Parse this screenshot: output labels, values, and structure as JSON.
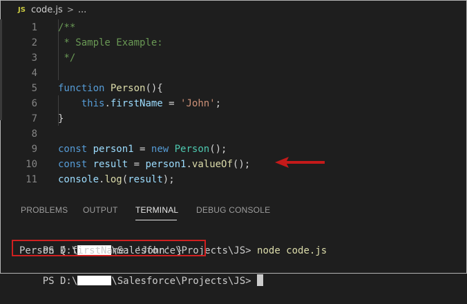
{
  "breadcrumb": {
    "badge": "JS",
    "file": "code.js",
    "separator": ">",
    "more": "..."
  },
  "editor": {
    "lines": [
      {
        "n": "1",
        "tokens": [
          [
            "cm",
            "/**"
          ]
        ]
      },
      {
        "n": "2",
        "tokens": [
          [
            "cm",
            " * Sample Example:"
          ]
        ]
      },
      {
        "n": "3",
        "tokens": [
          [
            "cm",
            " */"
          ]
        ]
      },
      {
        "n": "4",
        "tokens": []
      },
      {
        "n": "5",
        "tokens": [
          [
            "kw",
            "function "
          ],
          [
            "fn",
            "Person"
          ],
          [
            "plain",
            "(){"
          ]
        ]
      },
      {
        "n": "6",
        "tokens": [
          [
            "plain",
            "    "
          ],
          [
            "kw",
            "this"
          ],
          [
            "plain",
            "."
          ],
          [
            "var",
            "firstName"
          ],
          [
            "plain",
            " = "
          ],
          [
            "str",
            "'John'"
          ],
          [
            "plain",
            ";"
          ]
        ]
      },
      {
        "n": "7",
        "tokens": [
          [
            "plain",
            "}"
          ]
        ]
      },
      {
        "n": "8",
        "tokens": []
      },
      {
        "n": "9",
        "tokens": [
          [
            "kw",
            "const "
          ],
          [
            "var",
            "person1"
          ],
          [
            "plain",
            " = "
          ],
          [
            "kw",
            "new "
          ],
          [
            "cls",
            "Person"
          ],
          [
            "plain",
            "();"
          ]
        ]
      },
      {
        "n": "10",
        "tokens": [
          [
            "kw",
            "const "
          ],
          [
            "var",
            "result"
          ],
          [
            "plain",
            " = "
          ],
          [
            "var",
            "person1"
          ],
          [
            "plain",
            "."
          ],
          [
            "fn",
            "valueOf"
          ],
          [
            "plain",
            "();"
          ]
        ]
      },
      {
        "n": "11",
        "tokens": [
          [
            "var",
            "console"
          ],
          [
            "plain",
            "."
          ],
          [
            "fn",
            "log"
          ],
          [
            "plain",
            "("
          ],
          [
            "var",
            "result"
          ],
          [
            "plain",
            ");"
          ]
        ]
      }
    ]
  },
  "panel": {
    "tabs": [
      "PROBLEMS",
      "OUTPUT",
      "TERMINAL",
      "DEBUG CONSOLE"
    ],
    "active_tab": "TERMINAL"
  },
  "terminal": {
    "prompt_prefix": "PS D:\\",
    "prompt_suffix": "\\Salesforce\\Projects\\JS>",
    "command": "node code.js",
    "output": "Person { firstName: 'John' }"
  },
  "colors": {
    "background": "#1e1e1e",
    "annotation_red": "#d02020"
  }
}
